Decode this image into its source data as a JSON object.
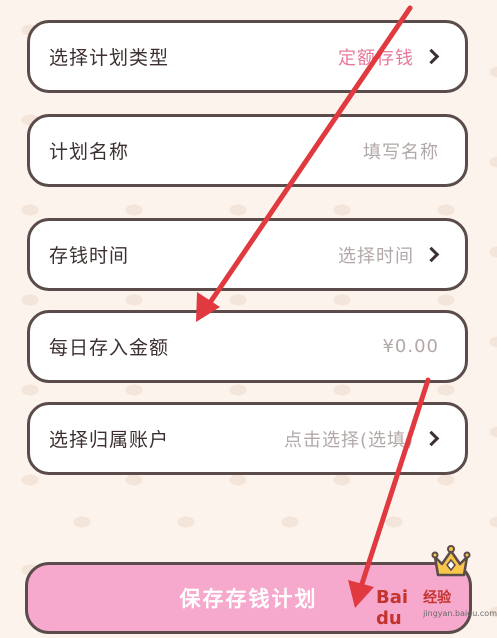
{
  "form": {
    "plan_type": {
      "label": "选择计划类型",
      "value": "定额存钱"
    },
    "plan_name": {
      "label": "计划名称",
      "placeholder": "填写名称"
    },
    "save_time": {
      "label": "存钱时间",
      "placeholder": "选择时间"
    },
    "daily_amount": {
      "label": "每日存入金额",
      "placeholder": "¥0.00"
    },
    "account": {
      "label": "选择归属账户",
      "placeholder": "点击选择(选填)"
    }
  },
  "save_button": {
    "label": "保存存钱计划"
  },
  "watermark": {
    "logo": "Bai du",
    "title": "经验",
    "url": "jingyan.baidu.com"
  },
  "colors": {
    "accent_pink_text": "#e9799a",
    "button_pink": "#f6a9cd",
    "border": "#5b4b4b",
    "arrow_red": "#e0393f"
  },
  "icons": [
    "chevron-right-icon",
    "crown-icon",
    "annotation-arrow"
  ]
}
